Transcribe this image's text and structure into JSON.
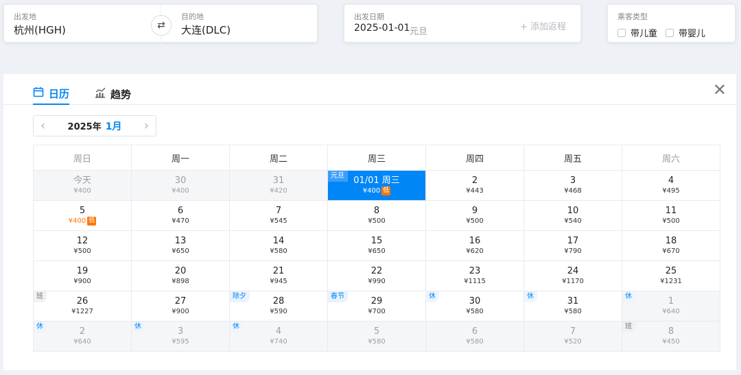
{
  "search": {
    "from_label": "出发地",
    "from_value": "杭州(HGH)",
    "to_label": "目的地",
    "to_value": "大连(DLC)",
    "swap_icon": "⇄",
    "date_label": "出发日期",
    "date_value": "2025-01-01",
    "date_holiday": "元旦",
    "add_return": "+ 添加返程",
    "pax_label": "乘客类型",
    "pax_child": "带儿童",
    "pax_infant": "带婴儿"
  },
  "tabs": {
    "calendar": "日历",
    "trend": "趋势",
    "calendar_icon": "calendar-icon",
    "trend_icon": "trend-chart-icon",
    "close_glyph": "✕"
  },
  "month_nav": {
    "prev": "‹",
    "next": "›",
    "year": "2025年",
    "month": "1月"
  },
  "weekdays": [
    "周日",
    "周一",
    "周二",
    "周三",
    "周四",
    "周五",
    "周六"
  ],
  "weeks": [
    [
      {
        "day": "今天",
        "price": "¥400",
        "other": true
      },
      {
        "day": "30",
        "price": "¥400",
        "other": true
      },
      {
        "day": "31",
        "price": "¥420",
        "other": true
      },
      {
        "day": "01/01 周三",
        "price": "¥400",
        "selected": true,
        "low": true,
        "tag": "元旦",
        "tagType": "fest"
      },
      {
        "day": "2",
        "price": "¥443"
      },
      {
        "day": "3",
        "price": "¥468"
      },
      {
        "day": "4",
        "price": "¥495"
      }
    ],
    [
      {
        "day": "5",
        "price": "¥400",
        "low": true,
        "lowPrice": true
      },
      {
        "day": "6",
        "price": "¥470"
      },
      {
        "day": "7",
        "price": "¥545"
      },
      {
        "day": "8",
        "price": "¥500"
      },
      {
        "day": "9",
        "price": "¥500"
      },
      {
        "day": "10",
        "price": "¥540"
      },
      {
        "day": "11",
        "price": "¥500"
      }
    ],
    [
      {
        "day": "12",
        "price": "¥500"
      },
      {
        "day": "13",
        "price": "¥650"
      },
      {
        "day": "14",
        "price": "¥580"
      },
      {
        "day": "15",
        "price": "¥650"
      },
      {
        "day": "16",
        "price": "¥620"
      },
      {
        "day": "17",
        "price": "¥790"
      },
      {
        "day": "18",
        "price": "¥670"
      }
    ],
    [
      {
        "day": "19",
        "price": "¥900"
      },
      {
        "day": "20",
        "price": "¥898"
      },
      {
        "day": "21",
        "price": "¥945"
      },
      {
        "day": "22",
        "price": "¥990"
      },
      {
        "day": "23",
        "price": "¥1115"
      },
      {
        "day": "24",
        "price": "¥1170"
      },
      {
        "day": "25",
        "price": "¥1231"
      }
    ],
    [
      {
        "day": "26",
        "price": "¥1227",
        "tag": "班",
        "tagType": "work"
      },
      {
        "day": "27",
        "price": "¥900"
      },
      {
        "day": "28",
        "price": "¥590",
        "tag": "除夕",
        "tagType": "fest"
      },
      {
        "day": "29",
        "price": "¥700",
        "tag": "春节",
        "tagType": "fest"
      },
      {
        "day": "30",
        "price": "¥580",
        "tag": "休",
        "tagType": "rest"
      },
      {
        "day": "31",
        "price": "¥580",
        "tag": "休",
        "tagType": "rest"
      },
      {
        "day": "1",
        "price": "¥640",
        "other": true,
        "tag": "休",
        "tagType": "rest"
      }
    ],
    [
      {
        "day": "2",
        "price": "¥640",
        "other": true,
        "tag": "休",
        "tagType": "rest"
      },
      {
        "day": "3",
        "price": "¥595",
        "other": true,
        "tag": "休",
        "tagType": "rest"
      },
      {
        "day": "4",
        "price": "¥740",
        "other": true,
        "tag": "休",
        "tagType": "rest"
      },
      {
        "day": "5",
        "price": "¥580",
        "other": true
      },
      {
        "day": "6",
        "price": "¥580",
        "other": true
      },
      {
        "day": "7",
        "price": "¥520",
        "other": true
      },
      {
        "day": "8",
        "price": "¥450",
        "other": true,
        "tag": "班",
        "tagType": "work"
      }
    ]
  ],
  "low_badge": "低",
  "colors": {
    "accent": "#0086f6",
    "low_price": "#ff7700"
  }
}
